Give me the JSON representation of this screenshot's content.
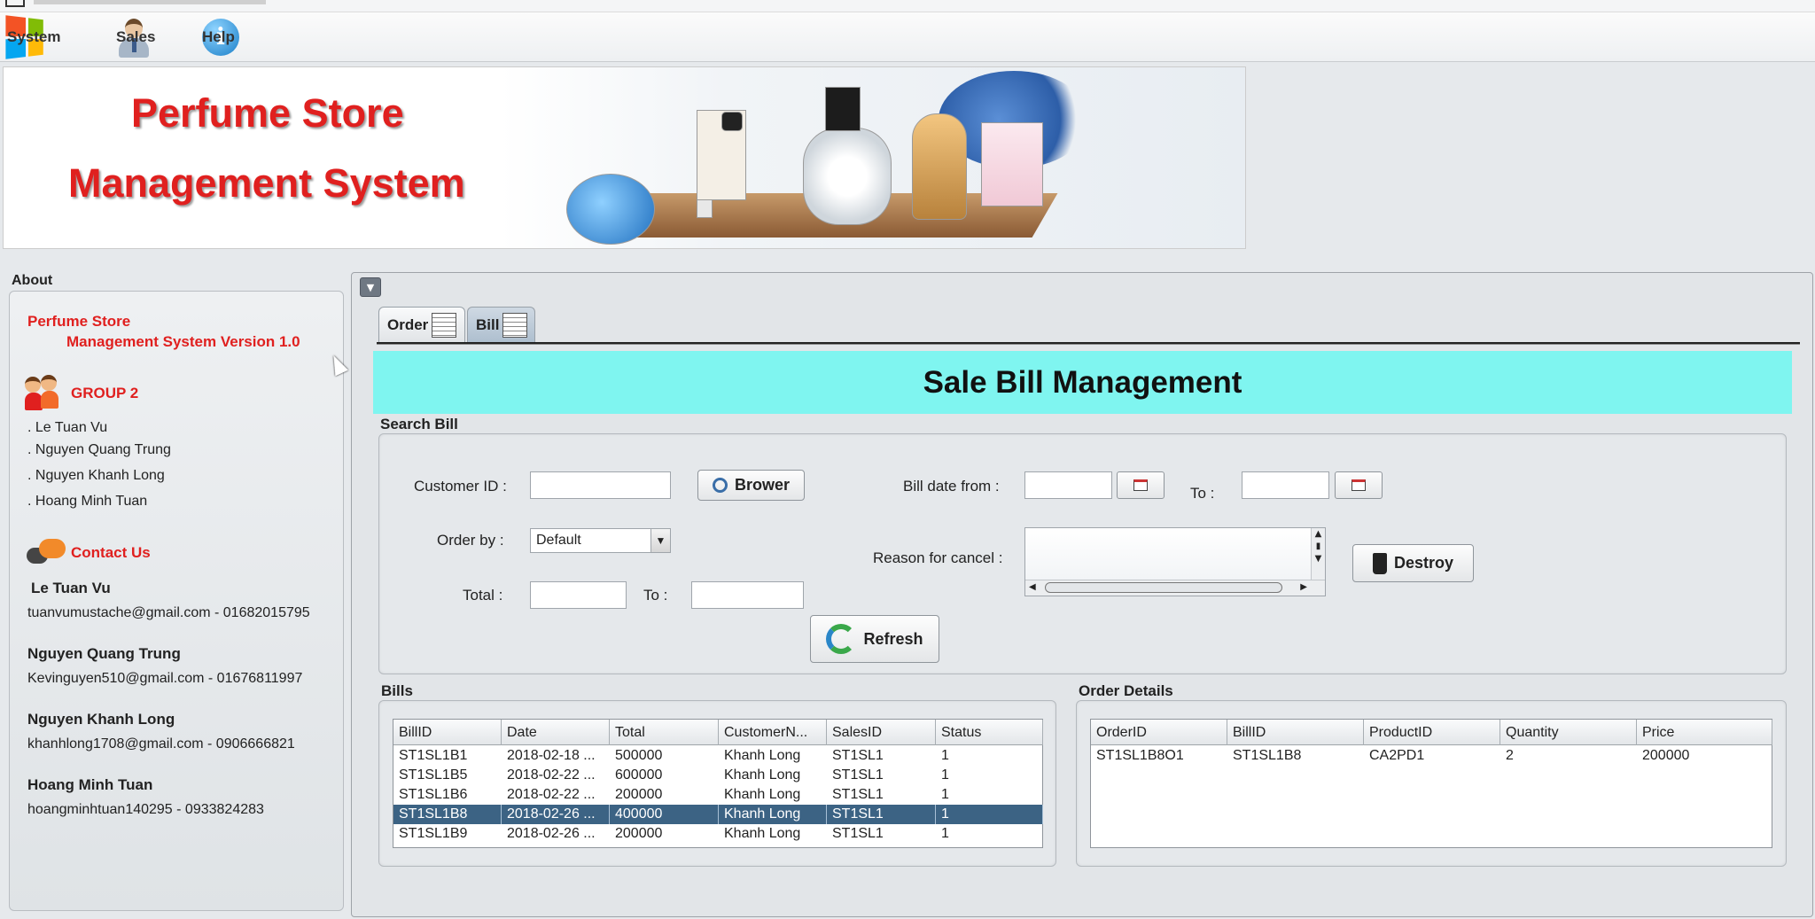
{
  "menu": {
    "system": "System",
    "sales": "Sales",
    "help": "Help"
  },
  "banner": {
    "line1": "Perfume Store",
    "line2": "Management System"
  },
  "about": {
    "title": "About",
    "product_line1": "Perfume Store",
    "product_line2": "Management System Version 1.0",
    "group": "GROUP 2",
    "members": [
      ". Le Tuan Vu",
      ". Nguyen Quang Trung",
      ". Nguyen Khanh Long",
      ". Hoang Minh Tuan"
    ],
    "contact_title": "Contact Us",
    "contacts": [
      {
        "name": "Le Tuan Vu",
        "info": "tuanvumustache@gmail.com - 01682015795"
      },
      {
        "name": "Nguyen Quang Trung",
        "info": "Kevinguyen510@gmail.com - 01676811997"
      },
      {
        "name": "Nguyen Khanh Long",
        "info": "khanhlong1708@gmail.com - 0906666821"
      },
      {
        "name": "Hoang Minh Tuan",
        "info": "hoangminhtuan140295 - 0933824283"
      }
    ]
  },
  "tabs": {
    "order": "Order",
    "bill": "Bill"
  },
  "main": {
    "header": "Sale Bill Management"
  },
  "search": {
    "title": "Search Bill",
    "customer_id_label": "Customer ID :",
    "customer_id_value": "",
    "browse_button": "Brower",
    "bill_date_from_label": "Bill date from :",
    "to_label": "To :",
    "order_by_label": "Order by :",
    "order_by_value": "Default",
    "reason_label": "Reason for cancel :",
    "destroy_button": "Destroy",
    "total_label": "Total :",
    "total_to_label": "To :",
    "refresh_button": "Refresh"
  },
  "bills": {
    "title": "Bills",
    "columns": [
      "BillID",
      "Date",
      "Total",
      "CustomerN...",
      "SalesID",
      "Status"
    ],
    "rows": [
      [
        "ST1SL1B1",
        "2018-02-18 ...",
        "500000",
        "Khanh Long",
        "ST1SL1",
        "1"
      ],
      [
        "ST1SL1B5",
        "2018-02-22 ...",
        "600000",
        "Khanh Long",
        "ST1SL1",
        "1"
      ],
      [
        "ST1SL1B6",
        "2018-02-22 ...",
        "200000",
        "Khanh Long",
        "ST1SL1",
        "1"
      ],
      [
        "ST1SL1B8",
        "2018-02-26 ...",
        "400000",
        "Khanh Long",
        "ST1SL1",
        "1"
      ],
      [
        "ST1SL1B9",
        "2018-02-26 ...",
        "200000",
        "Khanh Long",
        "ST1SL1",
        "1"
      ]
    ],
    "selected_row": 3
  },
  "order_details": {
    "title": "Order Details",
    "columns": [
      "OrderID",
      "BillID",
      "ProductID",
      "Quantity",
      "Price"
    ],
    "rows": [
      [
        "ST1SL1B8O1",
        "ST1SL1B8",
        "CA2PD1",
        "2",
        "200000"
      ]
    ]
  },
  "colors": {
    "accent_red": "#e0201f",
    "header_cyan": "#7ff5f0",
    "selection": "#3c6384"
  }
}
